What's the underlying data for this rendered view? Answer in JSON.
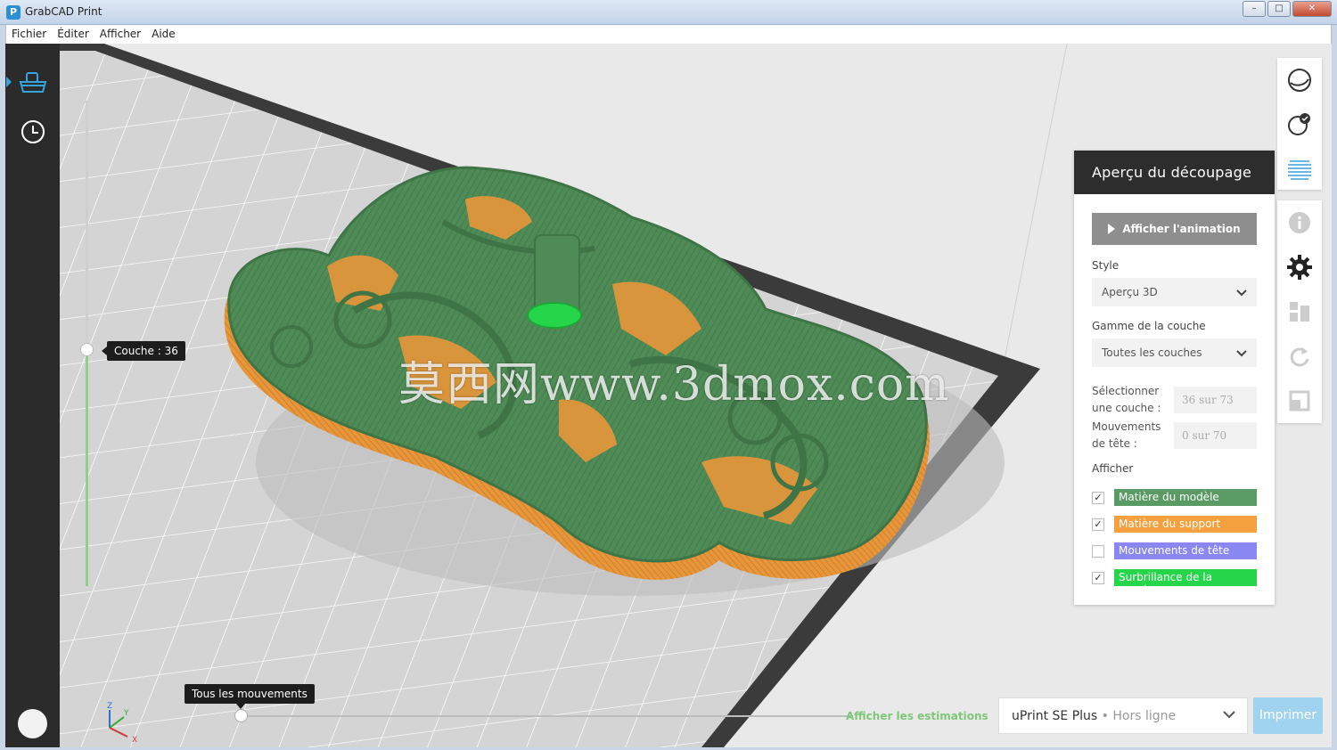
{
  "window": {
    "title": "GrabCAD Print",
    "minimize": "–",
    "maximize": "□",
    "close": "✕",
    "app_icon": "P"
  },
  "menu": [
    "Fichier",
    "Éditer",
    "Afficher",
    "Aide"
  ],
  "sidebar": {
    "items": [
      {
        "icon": "printer-tray-icon",
        "active": true
      },
      {
        "icon": "clock-icon",
        "active": false
      }
    ]
  },
  "viewport": {
    "layer_tooltip": "Couche : 36",
    "movement_tooltip": "Tous les mouvements",
    "estimations_link": "Afficher les estimations",
    "watermark": "莫西网www.3dmox.com",
    "axes": {
      "x": "X",
      "y": "Y",
      "z": "Z"
    }
  },
  "printer": {
    "name": "uPrint SE Plus",
    "separator": " • ",
    "status": "Hors ligne",
    "print_label": "Imprimer"
  },
  "panel": {
    "title": "Aperçu du découpage",
    "animation_button": "Afficher l'animation",
    "style_label": "Style",
    "style_value": "Aperçu 3D",
    "range_label": "Gamme de la couche",
    "range_value": "Toutes les couches",
    "select_layer_label": "Sélectionner une couche :",
    "select_layer_value": "36 sur 73",
    "head_moves_label": "Mouvements de tête :",
    "head_moves_value": "0 sur 70",
    "show_label": "Afficher",
    "legend": [
      {
        "label": "Matière du modèle",
        "color": "#5a9a63",
        "checked": true
      },
      {
        "label": "Matière du support",
        "color": "#f5a03f",
        "checked": true
      },
      {
        "label": "Mouvements de tête",
        "color": "#8a87f2",
        "checked": false
      },
      {
        "label": "Surbrillance de la couche",
        "color": "#26d64a",
        "checked": true
      }
    ]
  },
  "colors": {
    "model": "#4e8a56",
    "support": "#e8963a",
    "accent": "#36a3dc",
    "bed_frame": "#3a3a3a"
  }
}
